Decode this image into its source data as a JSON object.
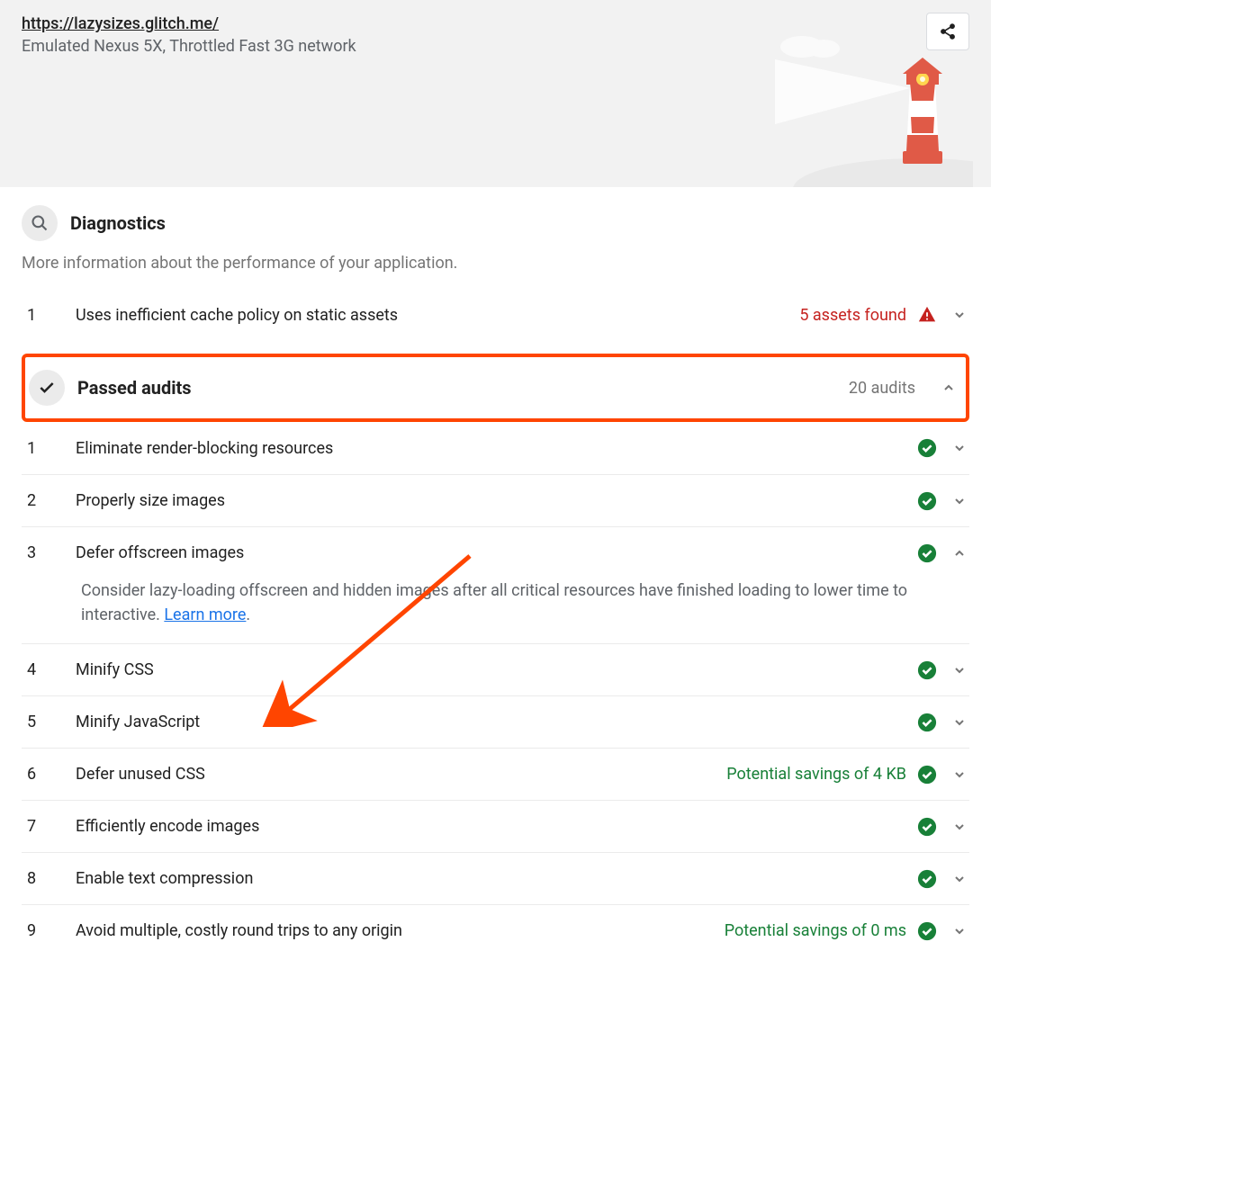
{
  "header": {
    "url": "https://lazysizes.glitch.me/",
    "subtitle": "Emulated Nexus 5X, Throttled Fast 3G network"
  },
  "diagnostics": {
    "title": "Diagnostics",
    "description": "More information about the performance of your application.",
    "items": [
      {
        "num": "1",
        "title": "Uses inefficient cache policy on static assets",
        "note": "5 assets found",
        "noteColor": "red",
        "status": "warn",
        "chev": "down"
      }
    ]
  },
  "passed": {
    "title": "Passed audits",
    "count": "20 audits",
    "items": [
      {
        "num": "1",
        "title": "Eliminate render-blocking resources",
        "chev": "down"
      },
      {
        "num": "2",
        "title": "Properly size images",
        "chev": "down"
      },
      {
        "num": "3",
        "title": "Defer offscreen images",
        "chev": "up",
        "detail": "Consider lazy-loading offscreen and hidden images after all critical resources have finished loading to lower time to interactive. ",
        "learn": "Learn more"
      },
      {
        "num": "4",
        "title": "Minify CSS",
        "chev": "down"
      },
      {
        "num": "5",
        "title": "Minify JavaScript",
        "chev": "down"
      },
      {
        "num": "6",
        "title": "Defer unused CSS",
        "note": "Potential savings of 4 KB",
        "chev": "down"
      },
      {
        "num": "7",
        "title": "Efficiently encode images",
        "chev": "down"
      },
      {
        "num": "8",
        "title": "Enable text compression",
        "chev": "down"
      },
      {
        "num": "9",
        "title": "Avoid multiple, costly round trips to any origin",
        "note": "Potential savings of 0 ms",
        "chev": "down"
      }
    ]
  }
}
